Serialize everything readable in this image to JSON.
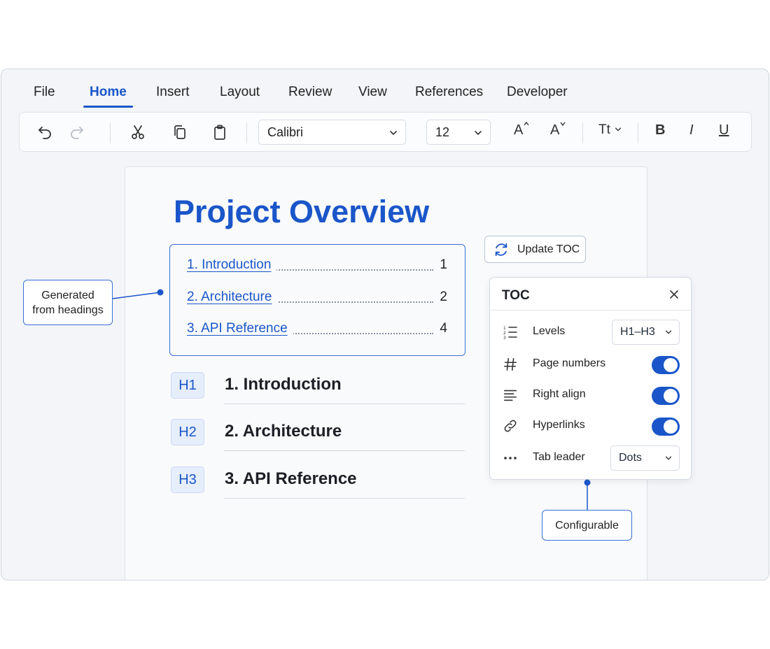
{
  "menu": {
    "tabs": [
      {
        "label": "File"
      },
      {
        "label": "Home",
        "active": true
      },
      {
        "label": "Insert"
      },
      {
        "label": "Layout"
      },
      {
        "label": "Review"
      },
      {
        "label": "View"
      },
      {
        "label": "References"
      },
      {
        "label": "Developer"
      }
    ]
  },
  "toolbar": {
    "icons": [
      "undo-icon",
      "redo-icon",
      "cut-icon",
      "copy-icon",
      "paste-icon"
    ],
    "font_name": "Calibri",
    "font_size": "12",
    "grow_font_label": "A",
    "shrink_font_label": "A",
    "text_effects_label": "Tt",
    "bold_label": "B",
    "italic_label": "I",
    "underline_label": "U"
  },
  "document": {
    "title": "Project Overview",
    "toc_entries": [
      {
        "label": "1.  Introduction",
        "page": "1"
      },
      {
        "label": "2.  Architecture",
        "page": "2"
      },
      {
        "label": "3.  API Reference",
        "page": "4"
      }
    ],
    "headings": [
      {
        "badge": "H1",
        "text": "1.  Introduction"
      },
      {
        "badge": "H2",
        "text": "2.  Architecture"
      },
      {
        "badge": "H3",
        "text": "3.  API Reference"
      }
    ]
  },
  "update_toc": {
    "label": "Update TOC"
  },
  "toc_panel": {
    "title": "TOC",
    "levels": {
      "label": "Levels",
      "value": "H1–H3"
    },
    "page_numbers": {
      "label": "Page numbers",
      "on": true
    },
    "right_align": {
      "label": "Right align",
      "on": true
    },
    "hyperlinks": {
      "label": "Hyperlinks",
      "on": true
    },
    "tab_leader": {
      "label": "Tab leader",
      "value": "Dots"
    }
  },
  "callouts": {
    "generated": "Generated\nfrom headings",
    "configurable": "Configurable"
  },
  "colors": {
    "accent": "#1a56c9",
    "border": "#3b6fd8"
  }
}
